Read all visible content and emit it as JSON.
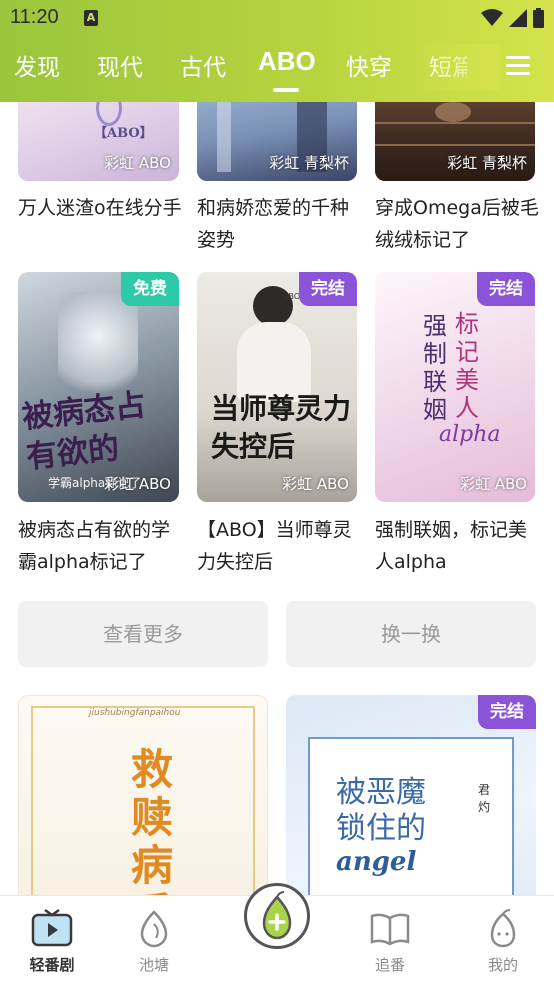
{
  "status_bar": {
    "time": "11:20",
    "notification": "A"
  },
  "tabs": [
    {
      "label": "发现"
    },
    {
      "label": "现代"
    },
    {
      "label": "古代"
    },
    {
      "label": "ABO"
    },
    {
      "label": "快穿"
    },
    {
      "label": "短篇"
    }
  ],
  "active_tab": "ABO",
  "books_row1": [
    {
      "title": "万人迷渣o在线分手",
      "source": "彩虹 ABO",
      "cover_text": "【ABO】"
    },
    {
      "title": "和病娇恋爱的千种姿势",
      "source": "彩虹 青梨杯"
    },
    {
      "title": "穿成Omega后被毛绒绒标记了",
      "source": "彩虹 青梨杯"
    }
  ],
  "books_row2": [
    {
      "title": "被病态占有欲的学霸alpha标记了",
      "source": "彩虹 ABO",
      "tag": "免费",
      "cover_text": "被病态占有欲的",
      "cover_sub": "学霸alpha标记了"
    },
    {
      "title": "【ABO】当师尊灵力失控后",
      "source": "彩虹 ABO",
      "tag": "完结",
      "cover_text": "当师尊灵力失控后",
      "cover_small": "ABO"
    },
    {
      "title": "强制联姻，标记美人alpha",
      "source": "彩虹 ABO",
      "tag": "完结",
      "cover_text_a": "强制联姻",
      "cover_text_b": "标记美人",
      "cover_text_c": "alpha"
    }
  ],
  "actions": {
    "more": "查看更多",
    "refresh": "换一换"
  },
  "books_row3": [
    {
      "cover_text": "救赎病反派",
      "cover_top": "jiushubingfanpaihou"
    },
    {
      "tag": "完结",
      "cover_text_a": "被恶魔",
      "cover_text_b": "锁住的",
      "cover_text_c": "angel",
      "cover_author": "君灼"
    }
  ],
  "bottom_nav": [
    {
      "label": "轻番剧",
      "icon": "tv-icon"
    },
    {
      "label": "池塘",
      "icon": "pond-icon"
    },
    {
      "label": "",
      "icon": "pear-add-icon"
    },
    {
      "label": "追番",
      "icon": "book-icon"
    },
    {
      "label": "我的",
      "icon": "pear-face-icon"
    }
  ],
  "colors": {
    "header_start": "#9ac53c",
    "header_end": "#d4e34b",
    "tag_free": "#2dcaa9",
    "tag_done": "#8a53d8"
  }
}
